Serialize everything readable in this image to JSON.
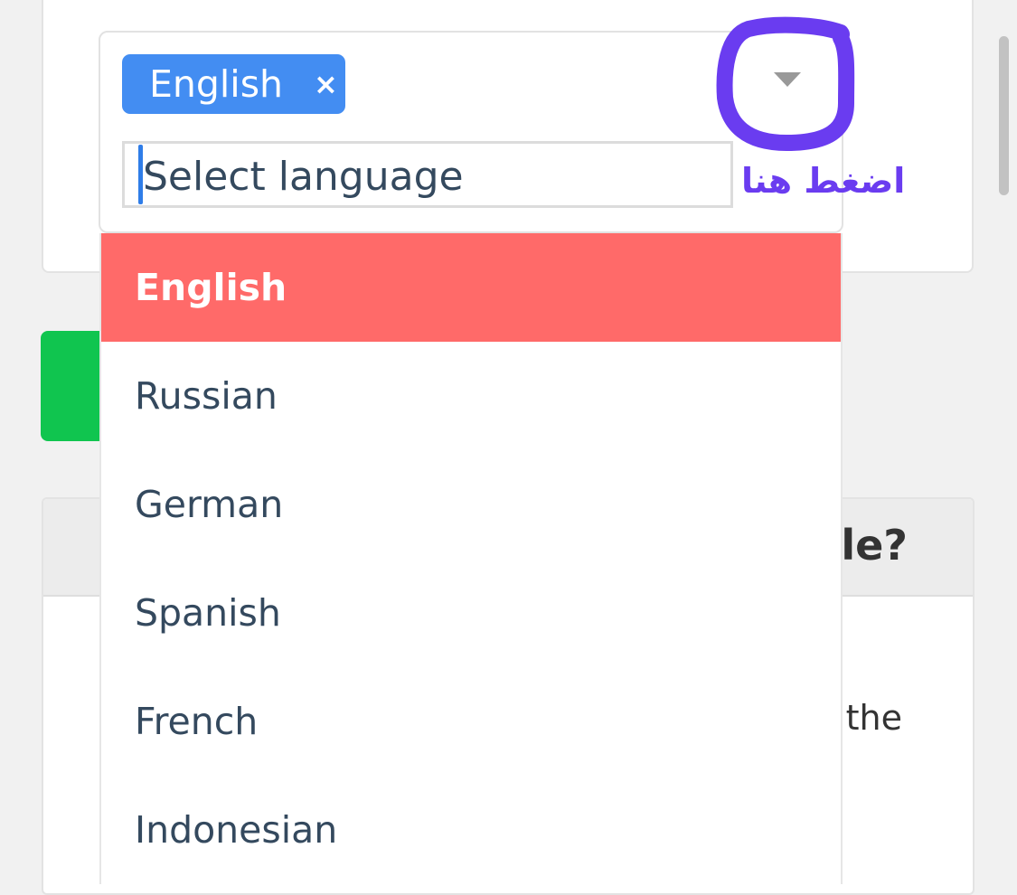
{
  "select": {
    "selected_tag": "English",
    "remove_symbol": "×",
    "placeholder": "Select language",
    "options": [
      {
        "label": "English",
        "highlighted": true
      },
      {
        "label": "Russian"
      },
      {
        "label": "German"
      },
      {
        "label": "Spanish"
      },
      {
        "label": "French"
      },
      {
        "label": "Indonesian"
      }
    ]
  },
  "annotation": {
    "text": "اضغط هنا",
    "color": "#6a3cf0"
  },
  "background_card": {
    "heading_fragment": "le?",
    "body_fragment": "the"
  },
  "colors": {
    "tag": "#438df2",
    "highlight": "#ff6a69",
    "green_button": "#10c54f"
  },
  "icons": {
    "dropdown": "triangle-down",
    "remove": "x-mark"
  }
}
